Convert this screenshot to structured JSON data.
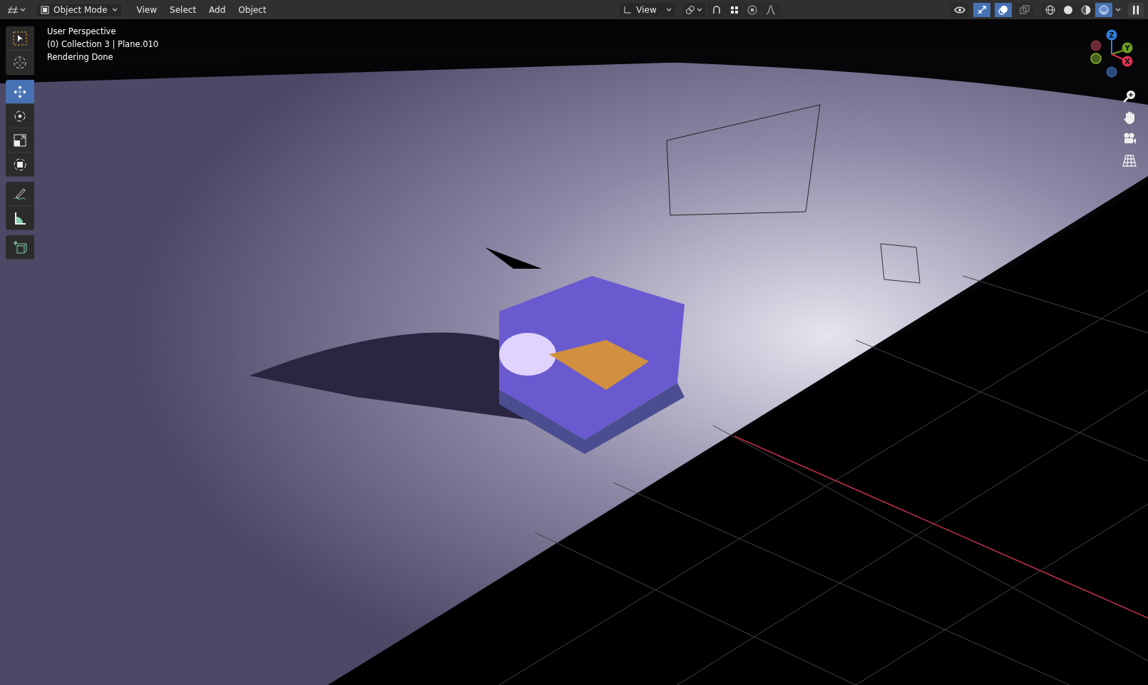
{
  "header": {
    "mode": "Object Mode",
    "menus": [
      "View",
      "Select",
      "Add",
      "Object"
    ],
    "orientation": "View",
    "toggles": [
      {
        "kind": "snap",
        "selected": false
      },
      {
        "kind": "snap_grid",
        "selected": false
      },
      {
        "kind": "proportional",
        "selected": false
      },
      {
        "kind": "falloff",
        "selected": false
      },
      {
        "kind": "visibility",
        "selected": false
      },
      {
        "kind": "gizmos",
        "selected": true
      },
      {
        "kind": "overlays",
        "selected": true
      },
      {
        "kind": "xray",
        "selected": false
      }
    ],
    "shading": [
      {
        "kind": "wireframe",
        "selected": false
      },
      {
        "kind": "solid",
        "selected": false
      },
      {
        "kind": "material",
        "selected": false
      },
      {
        "kind": "rendered",
        "selected": true
      }
    ]
  },
  "tools": [
    [
      {
        "kind": "select",
        "selected": false
      },
      {
        "kind": "cursor",
        "selected": false
      }
    ],
    [
      {
        "kind": "move",
        "selected": true
      },
      {
        "kind": "rotate",
        "selected": false
      },
      {
        "kind": "scale",
        "selected": false
      },
      {
        "kind": "transform",
        "selected": false
      }
    ],
    [
      {
        "kind": "annotate",
        "selected": false
      },
      {
        "kind": "measure",
        "selected": false
      }
    ],
    [
      {
        "kind": "add_cube",
        "selected": false
      }
    ]
  ],
  "overlay_text": [
    "User Perspective",
    "(0) Collection 3 | Plane.010",
    "Rendering Done"
  ],
  "gizmo": {
    "z": "Z",
    "y": "Y",
    "x": "X"
  }
}
